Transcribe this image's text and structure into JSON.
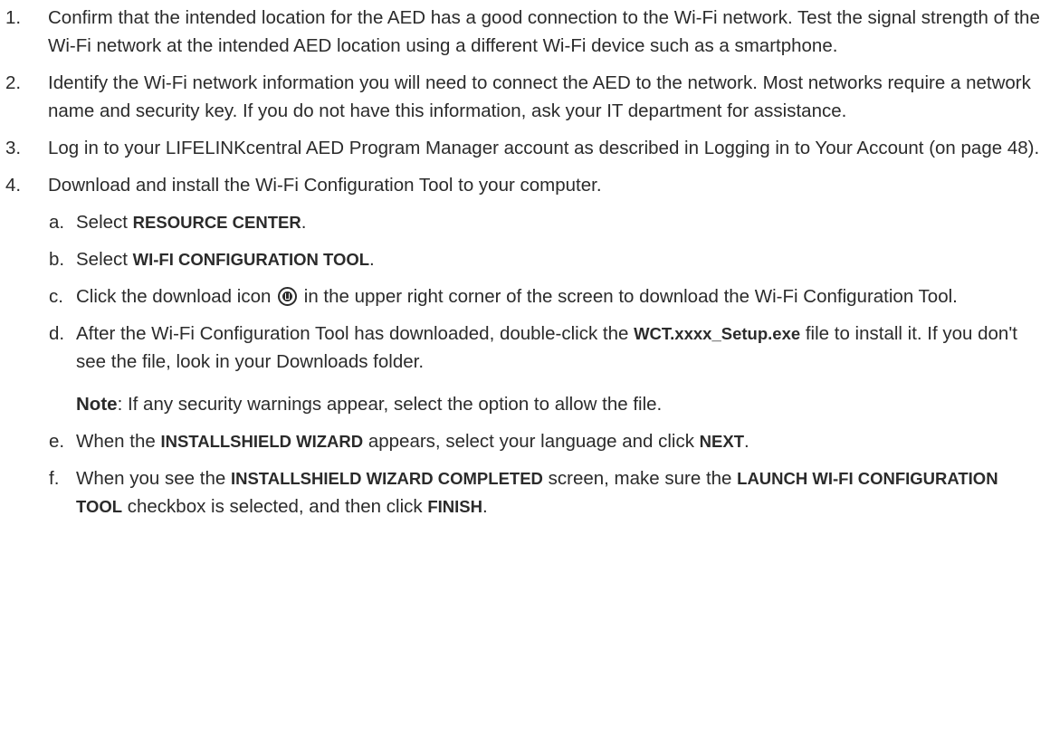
{
  "steps": [
    {
      "num": "1.",
      "text": "Confirm that the intended location for the AED has a good connection to the Wi-Fi network. Test the signal strength of the Wi-Fi network at the intended AED location using a different Wi-Fi device such as a smartphone."
    },
    {
      "num": "2.",
      "text": "Identify the Wi-Fi network information you will need to connect the AED to the network. Most networks require a network name and security key. If you do not have this information, ask your IT department for assistance."
    },
    {
      "num": "3.",
      "text": "Log in to your LIFELINKcentral AED Program Manager account as described in Logging in to Your Account (on page 48)."
    },
    {
      "num": "4.",
      "text": "Download and install the Wi-Fi Configuration Tool to your computer."
    }
  ],
  "substeps": {
    "a": {
      "letter": "a.",
      "pre": "Select ",
      "bold": "RESOURCE CENTER",
      "post": "."
    },
    "b": {
      "letter": "b.",
      "pre": "Select ",
      "bold": "WI-FI CONFIGURATION TOOL",
      "post": "."
    },
    "c": {
      "letter": "c.",
      "pre": "Click the download icon ",
      "post": " in the upper right corner of the screen to download the Wi-Fi Configuration Tool.",
      "icon": "download-icon"
    },
    "d": {
      "letter": "d.",
      "pre": "After the Wi-Fi Configuration Tool has downloaded, double-click the ",
      "bold": "WCT.xxxx_Setup.exe",
      "post": " file to install it. If you don't see the file, look in your Downloads folder."
    },
    "note": {
      "label": "Note",
      "text": ": If any security warnings appear, select the option to allow the file."
    },
    "e": {
      "letter": "e.",
      "pre": "When the ",
      "bold1": "INSTALLSHIELD WIZARD",
      "mid": " appears, select your language and click ",
      "bold2": "NEXT",
      "post": "."
    },
    "f": {
      "letter": "f.",
      "pre": "When you see the ",
      "bold1": "INSTALLSHIELD WIZARD COMPLETED",
      "mid1": " screen, make sure the ",
      "bold2": "LAUNCH WI-FI CONFIGURATION TOOL",
      "mid2": " checkbox is selected, and then click ",
      "bold3": "FINISH",
      "post": "."
    }
  }
}
